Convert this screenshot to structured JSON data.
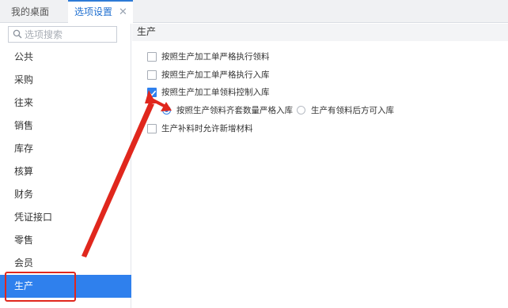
{
  "tabs": {
    "home_label": "我的桌面",
    "active_label": "选项设置",
    "close_glyph": "✕"
  },
  "sidebar": {
    "search_placeholder": "选项搜索",
    "items": [
      {
        "label": "公共"
      },
      {
        "label": "采购"
      },
      {
        "label": "往来"
      },
      {
        "label": "销售"
      },
      {
        "label": "库存"
      },
      {
        "label": "核算"
      },
      {
        "label": "财务"
      },
      {
        "label": "凭证接口"
      },
      {
        "label": "零售"
      },
      {
        "label": "会员"
      },
      {
        "label": "生产"
      }
    ],
    "active_index": 10
  },
  "content": {
    "section_title": "生产",
    "options": [
      {
        "label": "按照生产加工单严格执行领料",
        "checked": false
      },
      {
        "label": "按照生产加工单严格执行入库",
        "checked": false
      },
      {
        "label": "按照生产加工单领料控制入库",
        "checked": true
      },
      {
        "label": "生产补料时允许新增材料",
        "checked": false
      }
    ],
    "radios": [
      {
        "label": "按照生产领料齐套数量严格入库",
        "selected": true
      },
      {
        "label": "生产有领料后方可入库",
        "selected": false
      }
    ]
  },
  "colors": {
    "accent": "#2f80ed",
    "annotation": "#e0271d"
  }
}
